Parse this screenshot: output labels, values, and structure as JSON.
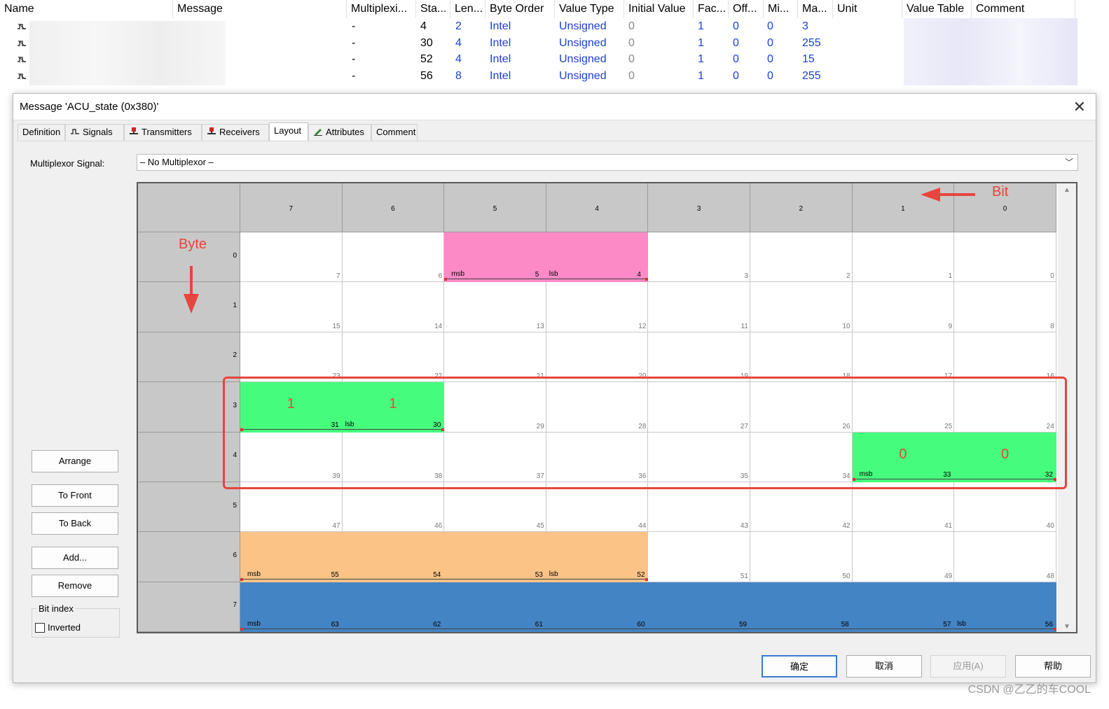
{
  "signal_table": {
    "columns": [
      "Name",
      "Message",
      "Multiplexi...",
      "Sta...",
      "Len...",
      "Byte Order",
      "Value Type",
      "Initial Value",
      "Fac...",
      "Off...",
      "Mi...",
      "Ma...",
      "Unit",
      "Value Table",
      "Comment"
    ],
    "rows": [
      {
        "multiplexor": "-",
        "start": "4",
        "length": "2",
        "byte_order": "Intel",
        "value_type": "Unsigned",
        "initial": "0",
        "factor": "1",
        "offset": "0",
        "min": "0",
        "max": "3"
      },
      {
        "multiplexor": "-",
        "start": "30",
        "length": "4",
        "byte_order": "Intel",
        "value_type": "Unsigned",
        "initial": "0",
        "factor": "1",
        "offset": "0",
        "min": "0",
        "max": "255"
      },
      {
        "multiplexor": "-",
        "start": "52",
        "length": "4",
        "byte_order": "Intel",
        "value_type": "Unsigned",
        "initial": "0",
        "factor": "1",
        "offset": "0",
        "min": "0",
        "max": "15"
      },
      {
        "multiplexor": "-",
        "start": "56",
        "length": "8",
        "byte_order": "Intel",
        "value_type": "Unsigned",
        "initial": "0",
        "factor": "1",
        "offset": "0",
        "min": "0",
        "max": "255"
      }
    ]
  },
  "dialog": {
    "title": "Message 'ACU_state (0x380)'",
    "close_glyph": "✕",
    "tabs": [
      "Definition",
      "Signals",
      "Transmitters",
      "Receivers",
      "Layout",
      "Attributes",
      "Comment"
    ],
    "active_tab": "Layout",
    "mux_label": "Multiplexor Signal:",
    "mux_value": "– No Multiplexor –",
    "buttons": {
      "arrange": "Arrange",
      "to_front": "To Front",
      "to_back": "To Back",
      "add": "Add...",
      "remove": "Remove"
    },
    "bit_index_label": "Bit index",
    "inverted_label": "Inverted",
    "footer": {
      "ok": "确定",
      "cancel": "取消",
      "apply": "应用(A)",
      "help": "帮助"
    }
  },
  "layout_grid": {
    "bit_headers": [
      "7",
      "6",
      "5",
      "4",
      "3",
      "2",
      "1",
      "0"
    ],
    "byte_rows": [
      "0",
      "1",
      "2",
      "3",
      "4",
      "5",
      "6",
      "7"
    ],
    "signals": [
      {
        "color": "#fb8ac7",
        "byte": 0,
        "from_col": 2,
        "to_col": 3,
        "labels": {
          "msb": "msb",
          "lsb": "lsb"
        }
      },
      {
        "color": "#46fc7c",
        "byte": 3,
        "from_col": 0,
        "to_col": 1,
        "labels": {
          "lsb": "lsb"
        },
        "values": [
          "1",
          "1"
        ]
      },
      {
        "color": "#46fc7c",
        "byte": 4,
        "from_col": 6,
        "to_col": 7,
        "labels": {
          "msb": "msb"
        },
        "values": [
          "0",
          "0"
        ]
      },
      {
        "color": "#fbc386",
        "byte": 6,
        "from_col": 0,
        "to_col": 3,
        "labels": {
          "msb": "msb",
          "lsb": "lsb"
        }
      },
      {
        "color": "#4384c4",
        "byte": 7,
        "from_col": 0,
        "to_col": 7,
        "labels": {
          "msb": "msb",
          "lsb": "lsb"
        }
      }
    ]
  },
  "annotations": {
    "bit": "Bit",
    "byte": "Byte"
  },
  "colors": {
    "accent_red": "#e8453c",
    "ok_border": "#3a7bd5"
  },
  "watermark": "CSDN @乙乙的车COOL"
}
